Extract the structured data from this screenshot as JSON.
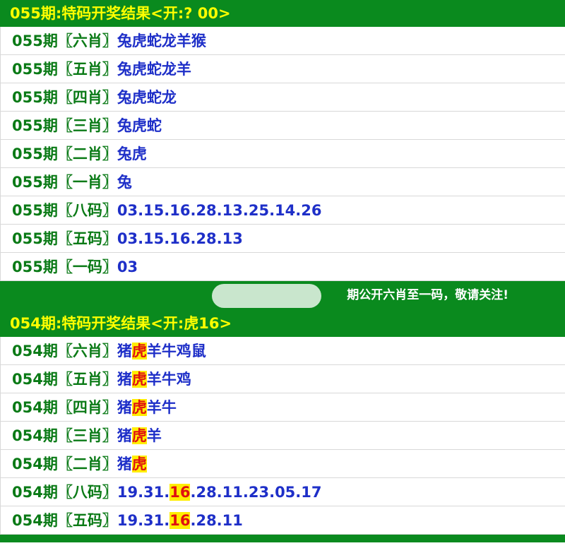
{
  "section1": {
    "header": "055期:特码开奖结果<开:? 00>",
    "rows": [
      {
        "prefix": "055期〖六肖〗",
        "value": "兔虎蛇龙羊猴"
      },
      {
        "prefix": "055期〖五肖〗",
        "value": "兔虎蛇龙羊"
      },
      {
        "prefix": "055期〖四肖〗",
        "value": "兔虎蛇龙"
      },
      {
        "prefix": "055期〖三肖〗",
        "value": "兔虎蛇"
      },
      {
        "prefix": "055期〖二肖〗",
        "value": "兔虎"
      },
      {
        "prefix": "055期〖一肖〗",
        "value": "兔"
      },
      {
        "prefix": "055期〖八码〗",
        "value": "03.15.16.28.13.25.14.26"
      },
      {
        "prefix": "055期〖五码〗",
        "value": "03.15.16.28.13"
      },
      {
        "prefix": "055期〖一码〗",
        "value": "03"
      }
    ]
  },
  "notice": {
    "text": "期公开六肖至一码，敬请关注!"
  },
  "section2": {
    "header": "054期:特码开奖结果<开:虎16>",
    "rows": [
      {
        "prefix": "054期〖六肖〗",
        "before": "猪",
        "hit": "虎",
        "after": "羊牛鸡鼠"
      },
      {
        "prefix": "054期〖五肖〗",
        "before": "猪",
        "hit": "虎",
        "after": "羊牛鸡"
      },
      {
        "prefix": "054期〖四肖〗",
        "before": "猪",
        "hit": "虎",
        "after": "羊牛"
      },
      {
        "prefix": "054期〖三肖〗",
        "before": "猪",
        "hit": "虎",
        "after": "羊"
      },
      {
        "prefix": "054期〖二肖〗",
        "before": "猪",
        "hit": "虎",
        "after": ""
      },
      {
        "prefix": "054期〖八码〗",
        "before": "19.31.",
        "hit": "16",
        "after": ".28.11.23.05.17"
      },
      {
        "prefix": "054期〖五码〗",
        "before": "19.31.",
        "hit": "16",
        "after": ".28.11"
      }
    ]
  },
  "colors": {
    "header_bg": "#0a8a1e",
    "header_text": "#ffff00",
    "prefix_text": "#0a7a16",
    "value_text": "#1e2fc8",
    "highlight_bg": "#ffee00",
    "highlight_text": "#e01010"
  }
}
